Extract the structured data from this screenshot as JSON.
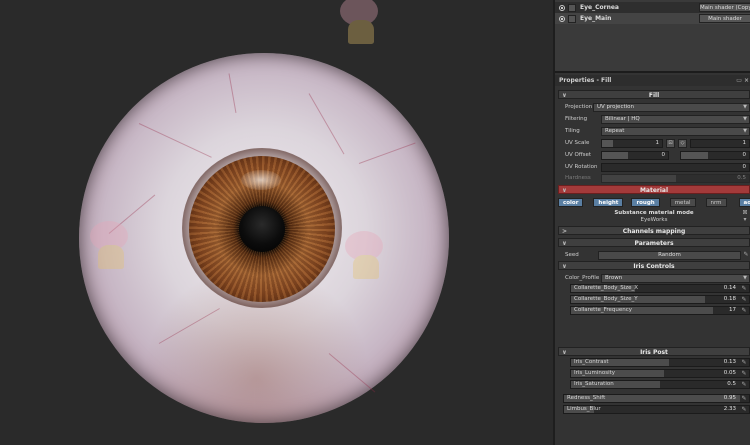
{
  "layers": [
    {
      "name": "Eye_Cornea",
      "shader": "Main shader (Copy)"
    },
    {
      "name": "Eye_Main",
      "shader": "Main shader"
    }
  ],
  "properties": {
    "title": "Properties - Fill",
    "fill_section": "Fill",
    "projection": {
      "label": "Projection",
      "value": "UV projection"
    },
    "filtering": {
      "label": "Filtering",
      "value": "Bilinear | HQ"
    },
    "tiling": {
      "label": "Tiling",
      "value": "Repeat"
    },
    "uv_scale": {
      "label": "UV Scale",
      "v1": "1",
      "v2": "1"
    },
    "uv_offset": {
      "label": "UV Offset",
      "v1": "0",
      "v2": "0"
    },
    "uv_rotation": {
      "label": "UV Rotation",
      "value": "0"
    },
    "hardness": {
      "label": "Hardness",
      "value": "0.5"
    }
  },
  "material": {
    "title": "Material",
    "channels": [
      "color",
      "height",
      "rough",
      "metal",
      "nrm",
      "ao"
    ],
    "active_channels": [
      "color",
      "height",
      "rough",
      "ao"
    ],
    "mode_label": "Substance material mode",
    "mode_value": "EyeWorks",
    "channels_mapping": "Channels mapping",
    "parameters": "Parameters",
    "seed": {
      "label": "Seed",
      "value": "Random"
    }
  },
  "iris_controls": {
    "title": "Iris Controls",
    "color_profile": {
      "label": "Color_Profile",
      "value": "Brown"
    },
    "params": [
      {
        "label": "Collarette_Body_Size_X",
        "value": "0.14",
        "fill": 0.36
      },
      {
        "label": "Collarette_Body_Size_Y",
        "value": "0.18",
        "fill": 0.75
      },
      {
        "label": "Collarette_Frequency",
        "value": "17",
        "fill": 0.8
      }
    ]
  },
  "iris_post": {
    "title": "Iris Post",
    "params": [
      {
        "label": "Iris_Contrast",
        "value": "0.13",
        "fill": 0.55
      },
      {
        "label": "Iris_Luminosity",
        "value": "0.05",
        "fill": 0.52
      },
      {
        "label": "Iris_Saturation",
        "value": "0.5",
        "fill": 0.5
      }
    ]
  },
  "extra_params": [
    {
      "label": "Redness_Shift",
      "value": "0.95",
      "fill": 0.95
    },
    {
      "label": "Limbus_Blur",
      "value": "2.33",
      "fill": 0.16
    }
  ],
  "colors": {
    "material_header": "#a33a3a",
    "channel_on": "#5a7fa3"
  }
}
